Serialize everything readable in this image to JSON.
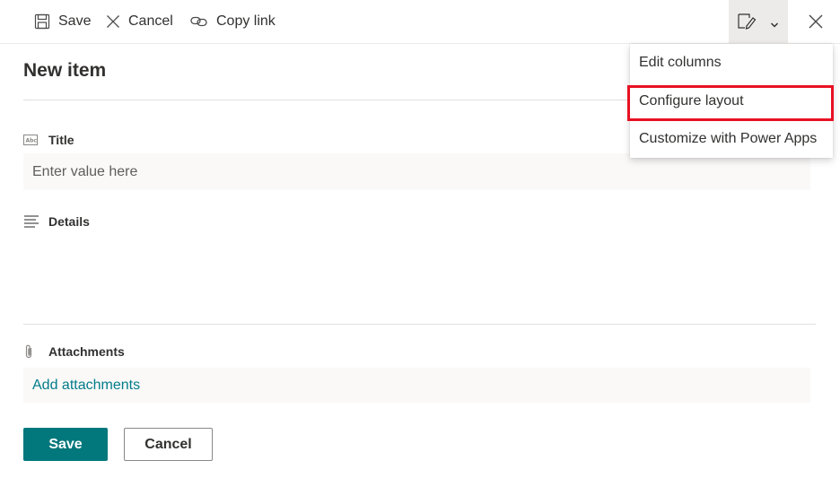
{
  "command_bar": {
    "save_label": "Save",
    "cancel_label": "Cancel",
    "copy_link_label": "Copy link"
  },
  "form": {
    "title": "New item",
    "fields": {
      "title": {
        "label": "Title",
        "placeholder": "Enter value here"
      },
      "details": {
        "label": "Details"
      },
      "attachments": {
        "label": "Attachments",
        "add_link": "Add attachments"
      }
    },
    "save_button": "Save",
    "cancel_button": "Cancel"
  },
  "menu": {
    "items": [
      {
        "label": "Edit columns"
      },
      {
        "label": "Configure layout",
        "highlighted": true
      },
      {
        "label": "Customize with Power Apps"
      }
    ]
  },
  "colors": {
    "accent": "#03787c",
    "link": "#037c8a",
    "highlight": "#e81123"
  }
}
